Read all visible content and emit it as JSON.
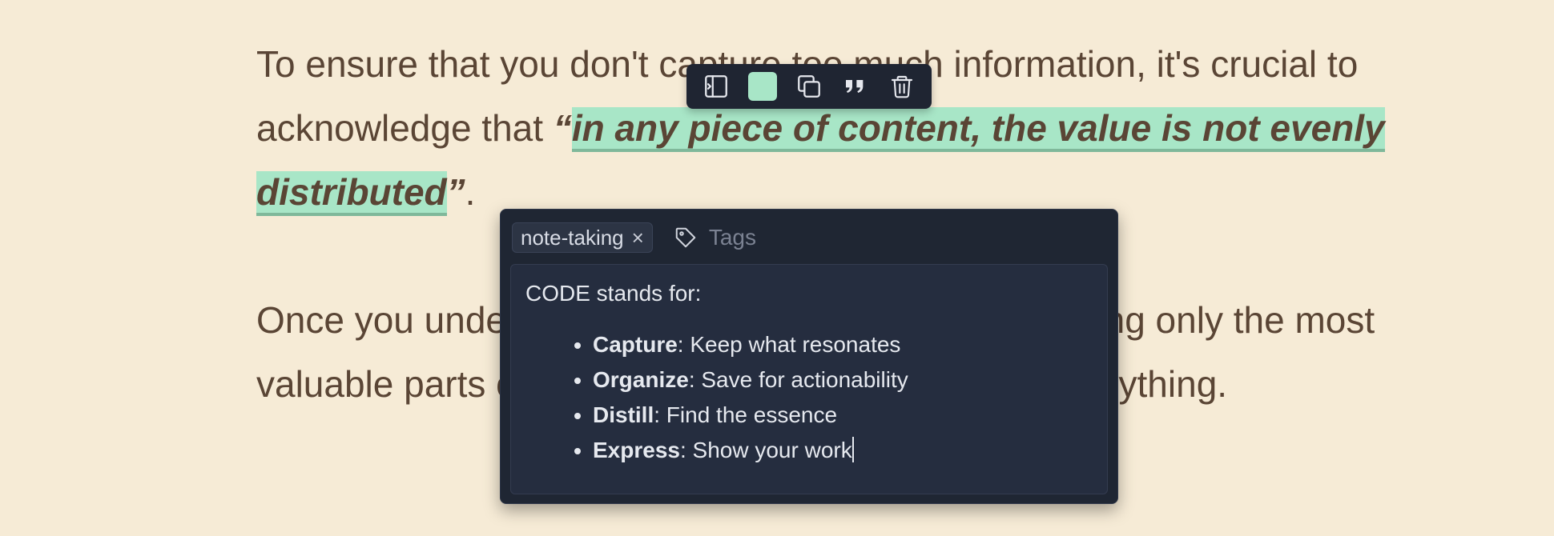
{
  "article": {
    "p1_before": "To ensure that you don't capture too much information, it's crucial to acknowledge that ",
    "p1_open_quote": "“",
    "p1_highlight": "in any piece of content, the value is not evenly distributed",
    "p1_close_quote": "”",
    "p1_after": ".",
    "p2": "Once you understand this, you can focus on extracting only the most valuable parts of your content, instead of saving everything."
  },
  "colors": {
    "background": "#f6ebd6",
    "text": "#5a4535",
    "highlight": "#a8e6c7",
    "panel": "#1f2633"
  },
  "toolbar": {
    "items": [
      {
        "icon": "sidebar-panel-icon"
      },
      {
        "icon": "highlight-color-swatch",
        "color": "#a8e6c7"
      },
      {
        "icon": "copy-icon"
      },
      {
        "icon": "quote-icon"
      },
      {
        "icon": "trash-icon"
      }
    ]
  },
  "note": {
    "tags": [
      "note-taking"
    ],
    "tag_remove_glyph": "×",
    "tag_input_placeholder": "Tags",
    "intro": "CODE stands for:",
    "items": [
      {
        "term": "Capture",
        "desc": ": Keep what resonates"
      },
      {
        "term": "Organize",
        "desc": ": Save for actionability"
      },
      {
        "term": "Distill",
        "desc": ": Find the essence"
      },
      {
        "term": "Express",
        "desc": ": Show your work"
      }
    ]
  }
}
